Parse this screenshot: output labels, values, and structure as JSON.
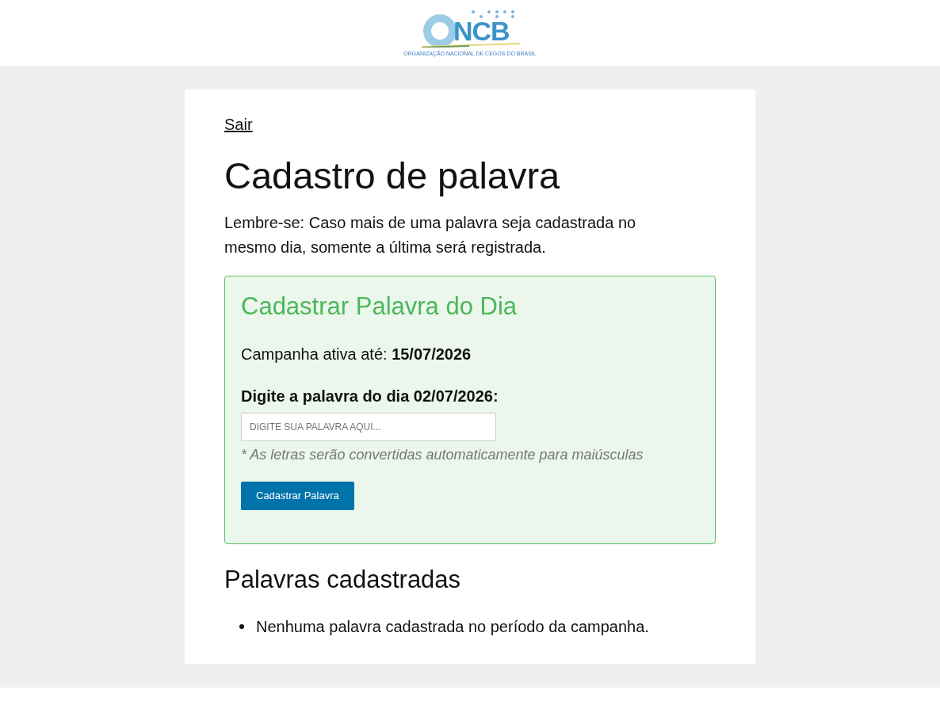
{
  "header": {
    "logo": {
      "letters": "NCB",
      "tagline": "ORGANIZAÇÃO NACIONAL DE CEGOS DO BRASIL"
    }
  },
  "page": {
    "logout_link": "Sair",
    "title": "Cadastro de palavra",
    "notice": "Lembre-se: Caso mais de uma palavra seja cadastrada no mesmo dia, somente a última será registrada."
  },
  "form": {
    "title": "Cadastrar Palavra do Dia",
    "campaign": "Campanha ativa até: **15/07/2026**",
    "field_label": "Digite a palavra do dia 02/07/2026:",
    "placeholder": "DIGITE SUA PALAVRA AQUI...",
    "hint": "* As letras serão convertidas automaticamente para maiúsculas",
    "submit": "Cadastrar Palavra"
  },
  "registered": {
    "title": "Palavras cadastradas",
    "items": [
      "Nenhuma palavra cadastrada no período da campanha."
    ]
  }
}
